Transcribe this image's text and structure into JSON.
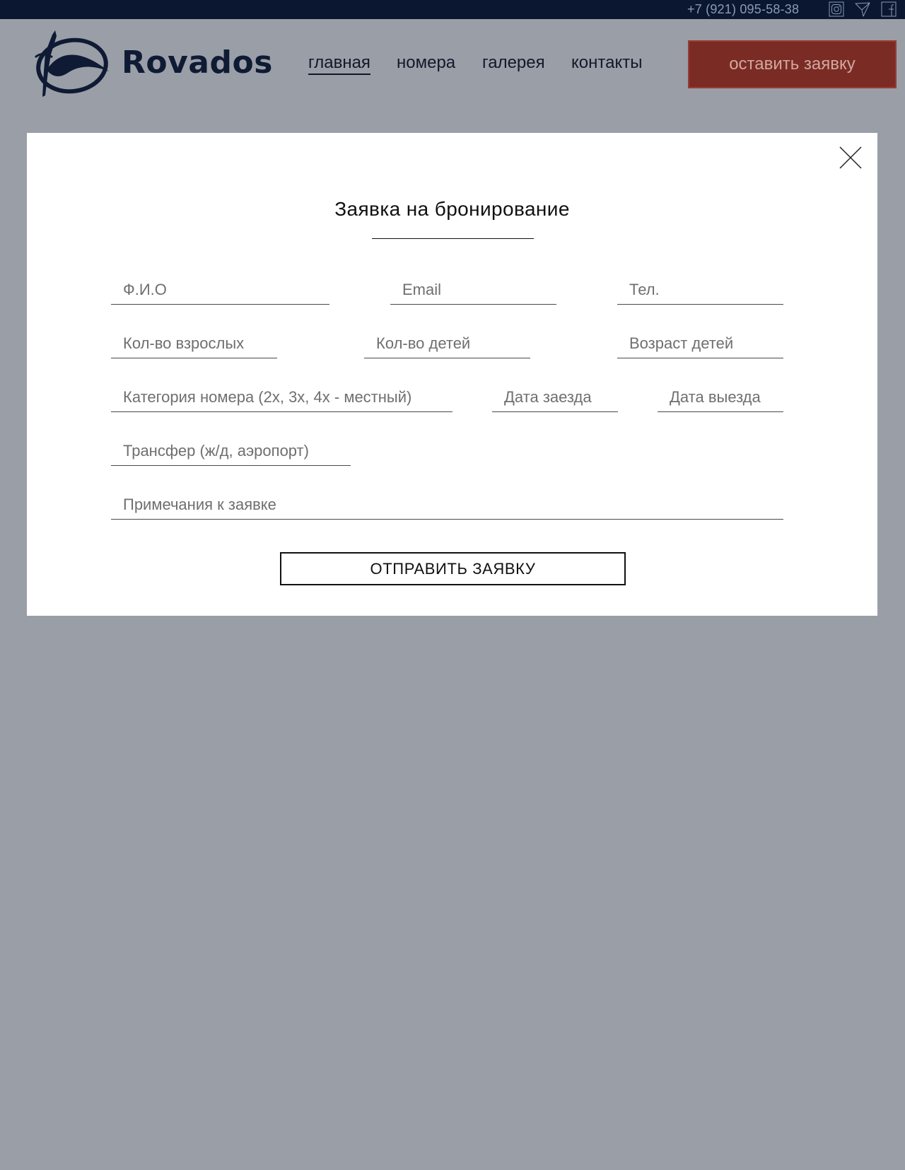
{
  "topbar": {
    "phone": "+7 (921) 095-58-38",
    "social_icons": [
      "instagram-icon",
      "telegram-icon",
      "facebook-icon"
    ]
  },
  "header": {
    "logo_text": "Rovados",
    "nav": {
      "items": [
        {
          "label": "главная",
          "active": true
        },
        {
          "label": "номера",
          "active": false
        },
        {
          "label": "галерея",
          "active": false
        },
        {
          "label": "контакты",
          "active": false
        }
      ]
    },
    "cta_label": "оставить заявку"
  },
  "modal": {
    "title": "Заявка на бронирование",
    "fields": {
      "name": {
        "placeholder": "Ф.И.О",
        "value": ""
      },
      "email": {
        "placeholder": "Email",
        "value": ""
      },
      "phone": {
        "placeholder": "Тел.",
        "value": ""
      },
      "adults": {
        "placeholder": "Кол-во взрослых",
        "value": ""
      },
      "kids": {
        "placeholder": "Кол-во детей",
        "value": ""
      },
      "kids_age": {
        "placeholder": "Возраст детей",
        "value": ""
      },
      "category": {
        "placeholder": "Категория номера (2х, 3х, 4х - местный)",
        "value": ""
      },
      "checkin": {
        "placeholder": "Дата заезда",
        "value": ""
      },
      "checkout": {
        "placeholder": "Дата выезда",
        "value": ""
      },
      "transfer": {
        "placeholder": "Трансфер (ж/д, аэропорт)",
        "value": ""
      },
      "notes": {
        "placeholder": "Примечания к заявке",
        "value": ""
      }
    },
    "submit_label": "ОТПРАВИТЬ ЗАЯВКУ",
    "close_icon": "close-icon"
  },
  "colors": {
    "topbar_bg": "#0b1730",
    "overlay_bg": "#9a9ea7",
    "brand_dark": "#0f1b34",
    "cta_bg": "#7a2c24",
    "modal_bg": "#ffffff"
  }
}
